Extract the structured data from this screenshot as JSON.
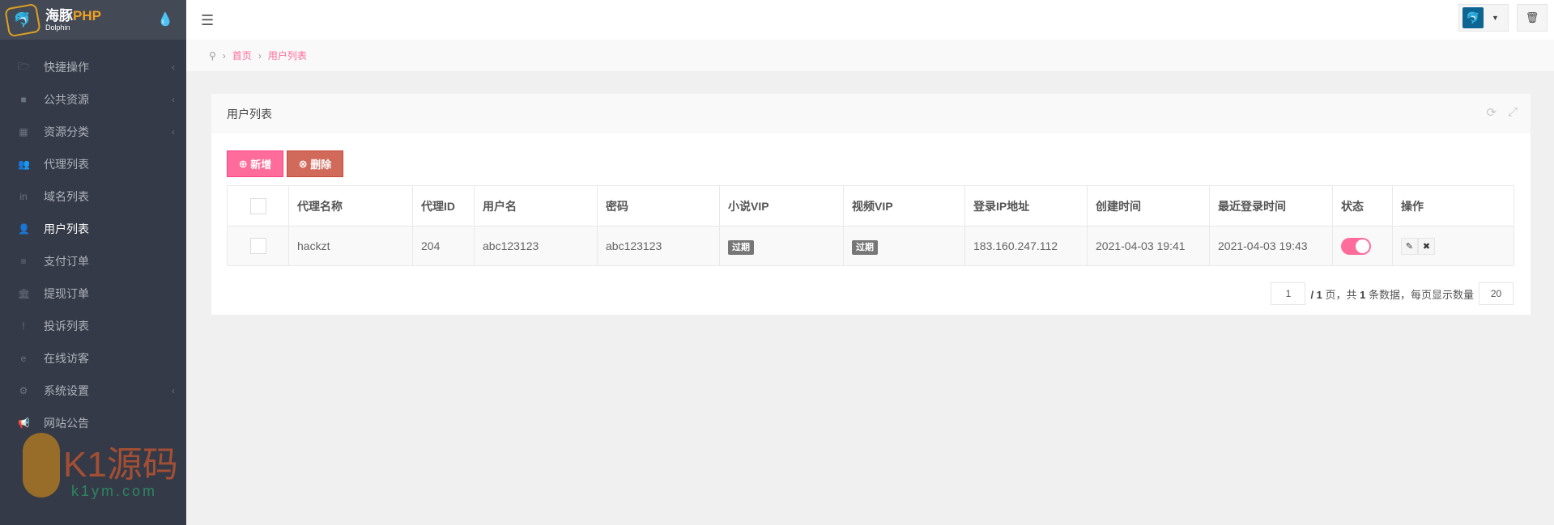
{
  "brand": {
    "name_cn": "海豚",
    "name_php": "PHP",
    "sub": "Dolphin"
  },
  "sidebar": {
    "items": [
      {
        "label": "快捷操作",
        "icon": "folder-open-icon",
        "ic": "🗁",
        "chevron": true
      },
      {
        "label": "公共资源",
        "icon": "video-camera-icon",
        "ic": "■",
        "chevron": true
      },
      {
        "label": "资源分类",
        "icon": "th-large-icon",
        "ic": "▦",
        "chevron": true
      },
      {
        "label": "代理列表",
        "icon": "users-icon",
        "ic": "👥",
        "chevron": false
      },
      {
        "label": "域名列表",
        "icon": "linkedin-icon",
        "ic": "in",
        "chevron": false
      },
      {
        "label": "用户列表",
        "icon": "user-icon",
        "ic": "👤",
        "chevron": false,
        "active": true
      },
      {
        "label": "支付订单",
        "icon": "database-icon",
        "ic": "≡",
        "chevron": false
      },
      {
        "label": "提现订单",
        "icon": "bank-icon",
        "ic": "🏛",
        "chevron": false
      },
      {
        "label": "投诉列表",
        "icon": "exclamation-circle-icon",
        "ic": "!",
        "chevron": false
      },
      {
        "label": "在线访客",
        "icon": "internet-explorer-icon",
        "ic": "e",
        "chevron": false
      },
      {
        "label": "系统设置",
        "icon": "gear-icon",
        "ic": "⚙",
        "chevron": true
      },
      {
        "label": "网站公告",
        "icon": "bullhorn-icon",
        "ic": "📢",
        "chevron": false
      }
    ]
  },
  "watermark": {
    "text": "K1源码",
    "sub": "k1ym.com"
  },
  "breadcrumb": {
    "home": "首页",
    "current": "用户列表"
  },
  "card": {
    "title": "用户列表",
    "add_label": "新增",
    "delete_label": "删除"
  },
  "table": {
    "headers": [
      "代理名称",
      "代理ID",
      "用户名",
      "密码",
      "小说VIP",
      "视频VIP",
      "登录IP地址",
      "创建时间",
      "最近登录时间",
      "状态",
      "操作"
    ],
    "rows": [
      {
        "agent": "hackzt",
        "agent_id": "204",
        "username": "abc123123",
        "password": "abc123123",
        "novel_vip": "过期",
        "video_vip": "过期",
        "ip": "183.160.247.112",
        "created": "2021-04-03 19:41",
        "last_login": "2021-04-03 19:43",
        "status_on": true
      }
    ]
  },
  "pager": {
    "page": "1",
    "sep": " / ",
    "total_pages": "1",
    "t1": " 页，共 ",
    "total": "1",
    "t2": " 条数据，每页显示数量",
    "page_size": "20"
  },
  "colors": {
    "accent": "#ff6b9a",
    "danger": "#d26a5c",
    "sidebar": "#343a47"
  }
}
